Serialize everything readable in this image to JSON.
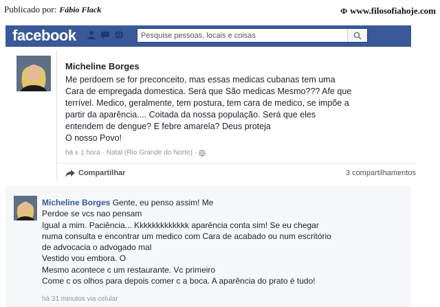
{
  "header": {
    "published_label": "Publicado por:",
    "author": "Fábio Flack",
    "site": "www.filosofiahoje.com"
  },
  "fb": {
    "logo": "facebook",
    "search_placeholder": "Pesquise pessoas, locais e coisas",
    "brand_color": "#3b5998"
  },
  "post": {
    "author": "Micheline Borges",
    "lines": [
      "Me perdoem se for preconceito, mas essas medicas cubanas tem uma",
      "Cara de empregada domestica. Será que São medicas Mesmo??? Afe que",
      "terrível. Medico, geralmente, tem postura, tem cara de medico, se impõe a",
      "partir da aparência.... Coitada da nossa população. Será que eles",
      "entendem de dengue? E febre amarela? Deus proteja",
      "O nosso Povo!"
    ],
    "meta_time": "há ± 1 hora",
    "meta_location": "Natal (Rio Grande do Norte)",
    "share_label": "Compartilhar",
    "share_count": "3 compartilhamentos"
  },
  "comment": {
    "author": "Micheline Borges",
    "first_text": "Gente, eu penso assim! Me",
    "lines": [
      "Perdoe se vcs nao pensam",
      "Igual a mim. Paciência... Kkkkkkkkkkkkk aparência conta sim! Se eu chegar",
      "numa consulta e encontrar um medico com Cara de acabado ou num escritório",
      "de advocacia o advogado mal",
      "Vestido vou embora. O",
      "Mesmo acontece c um restaurante. Vc primeiro",
      "Come c os olhos para depois comer c a boca. A aparência do prato é tudo!"
    ],
    "meta": "há 31 minutos via celular"
  }
}
